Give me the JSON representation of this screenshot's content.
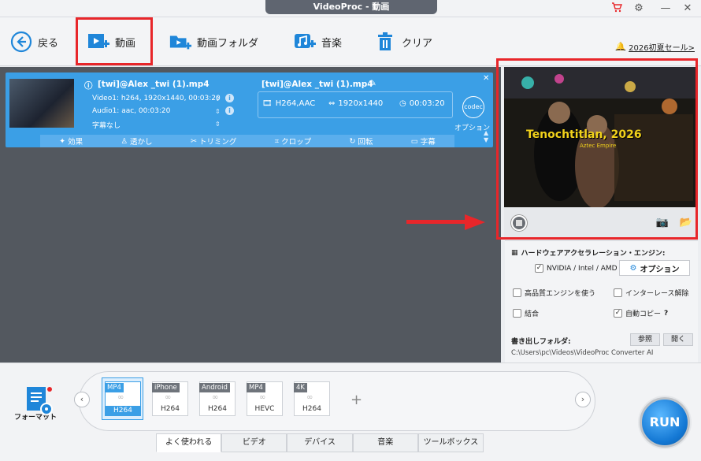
{
  "window": {
    "title": "VideoProc - 動画"
  },
  "toolbar": {
    "back_label": "戻る",
    "video_label": "動画",
    "video_folder_label": "動画フォルダ",
    "music_label": "音楽",
    "clear_label": "クリア",
    "promo_text": "2026初夏セール>"
  },
  "video_item": {
    "source_name": "[twi]@Alex _twi (1).mp4",
    "video_track": "Video1: h264, 1920x1440, 00:03:20",
    "audio_track": "Audio1: aac, 00:03:20",
    "subtitle_track": "字幕なし",
    "output_name": "[twi]@Alex _twi (1).mp4",
    "output_codec": "H264,AAC",
    "output_resolution": "1920x1440",
    "output_duration": "00:03:20",
    "codec_label": "codec",
    "option_label": "オプション",
    "edit": {
      "effect": "効果",
      "watermark": "透かし",
      "trim": "トリミング",
      "crop": "クロップ",
      "rotate": "回転",
      "subtitle": "字幕"
    }
  },
  "preview": {
    "overlay_title": "Tenochtitlan, 2026",
    "overlay_sub": "Aztec Empire"
  },
  "settings": {
    "hw_accel_label": "ハードウェアアクセラレーション・エンジン:",
    "gpu_label": "NVIDIA / Intel / AMD",
    "gpu_checked": true,
    "option_button": "オプション",
    "hq_engine_label": "高品質エンジンを使う",
    "hq_engine_checked": false,
    "deinterlace_label": "インターレース解除",
    "deinterlace_checked": false,
    "merge_label": "結合",
    "merge_checked": false,
    "autocopy_label": "自動コピー",
    "autocopy_help": "?",
    "autocopy_checked": true,
    "output_folder_label": "書き出しフォルダ:",
    "browse_button": "参照",
    "open_button": "開く",
    "output_path": "C:\\Users\\pc\\Videos\\VideoProc Converter AI"
  },
  "format_bar": {
    "format_label": "フォーマット",
    "presets": [
      {
        "tag": "MP4",
        "codec": "H264",
        "selected": true
      },
      {
        "tag": "iPhone",
        "codec": "H264",
        "selected": false
      },
      {
        "tag": "Android",
        "codec": "H264",
        "selected": false
      },
      {
        "tag": "MP4",
        "codec": "HEVC",
        "selected": false
      },
      {
        "tag": "4K",
        "codec": "H264",
        "selected": false
      }
    ],
    "tabs": [
      "よく使われる",
      "ビデオ",
      "デバイス",
      "音楽",
      "ツールボックス"
    ],
    "active_tab": 0
  },
  "run_button": "RUN",
  "colors": {
    "accent": "#3b9fe6",
    "highlight": "#e8262a",
    "preview_text": "#f2d21b"
  }
}
